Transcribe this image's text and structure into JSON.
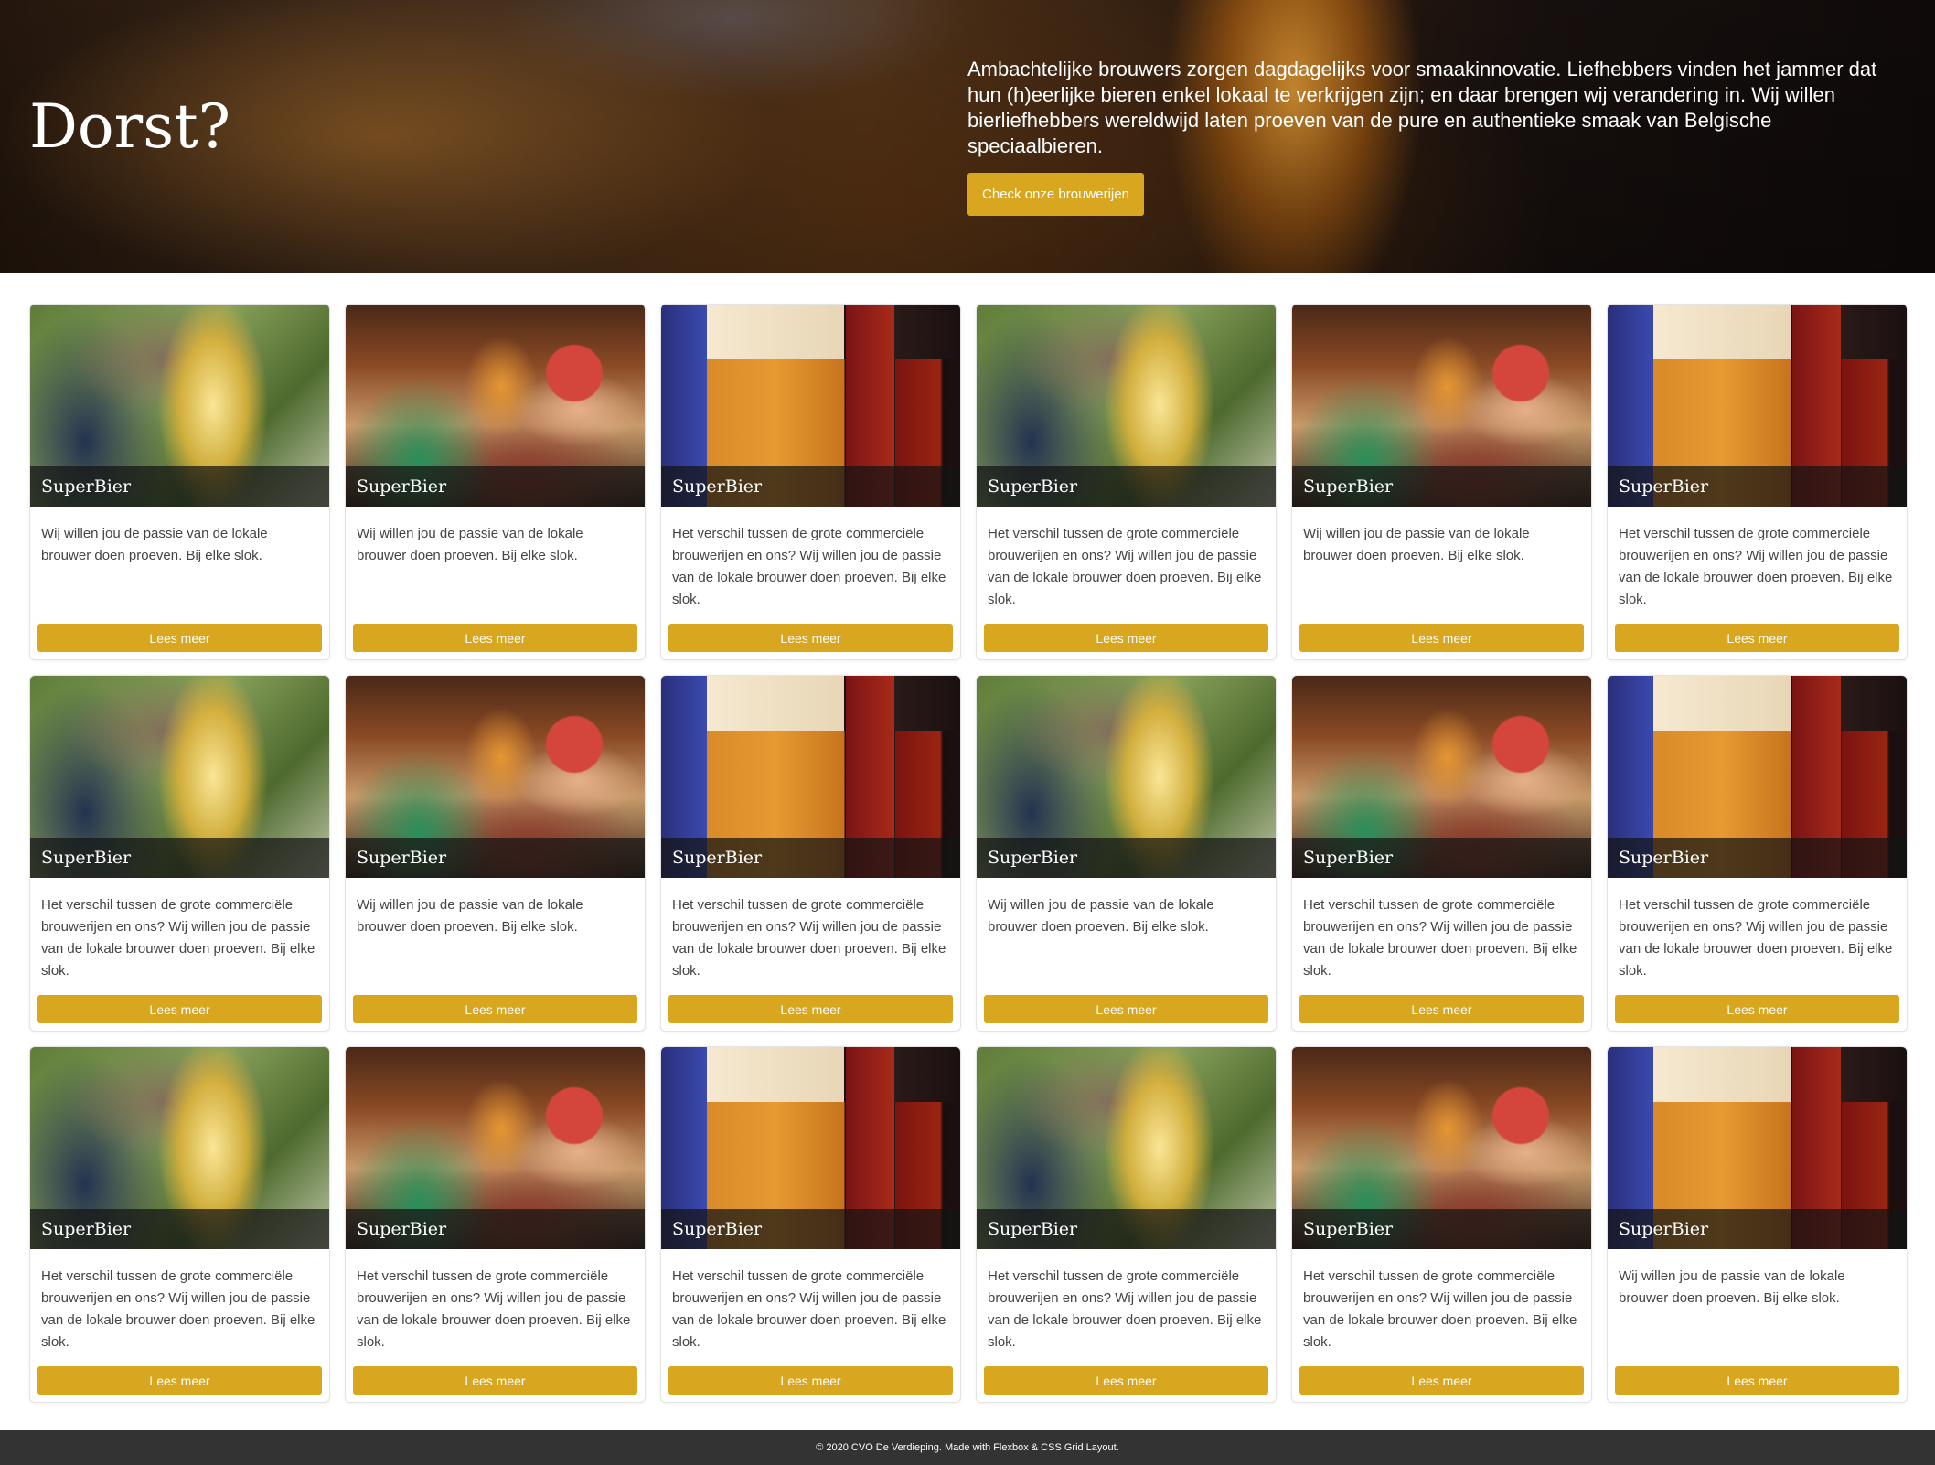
{
  "hero": {
    "title": "Dorst?",
    "text": "Ambachtelijke brouwers zorgen dagdagelijks voor smaakinnovatie. Liefhebbers vinden het jammer dat hun (h)eerlijke bieren enkel lokaal te verkrijgen zijn; en daar brengen wij verandering in. Wij willen bierliefhebbers wereldwijd laten proeven van de pure en authentieke smaak van Belgische speciaalbieren.",
    "button_label": "Check onze brouwerijen"
  },
  "cards": [
    {
      "title": "SuperBier",
      "text": "Wij willen jou de passie van de lokale brouwer doen proeven. Bij elke slok.",
      "button_label": "Lees meer",
      "photo": "beer-toast-hand"
    },
    {
      "title": "SuperBier",
      "text": "Wij willen jou de passie van de lokale brouwer doen proeven. Bij elke slok.",
      "button_label": "Lees meer",
      "photo": "people-cheering"
    },
    {
      "title": "SuperBier",
      "text": "Het verschil tussen de grote commerciële brouwerijen en ons? Wij willen jou de passie van de lokale brouwer doen proeven. Bij elke slok.",
      "button_label": "Lees meer",
      "photo": "beer-glasses"
    },
    {
      "title": "SuperBier",
      "text": "Het verschil tussen de grote commerciële brouwerijen en ons? Wij willen jou de passie van de lokale brouwer doen proeven. Bij elke slok.",
      "button_label": "Lees meer",
      "photo": "beer-toast-hand"
    },
    {
      "title": "SuperBier",
      "text": "Wij willen jou de passie van de lokale brouwer doen proeven. Bij elke slok.",
      "button_label": "Lees meer",
      "photo": "people-cheering"
    },
    {
      "title": "SuperBier",
      "text": "Het verschil tussen de grote commerciële brouwerijen en ons? Wij willen jou de passie van de lokale brouwer doen proeven. Bij elke slok.",
      "button_label": "Lees meer",
      "photo": "beer-glasses"
    },
    {
      "title": "SuperBier",
      "text": "Het verschil tussen de grote commerciële brouwerijen en ons? Wij willen jou de passie van de lokale brouwer doen proeven. Bij elke slok.",
      "button_label": "Lees meer",
      "photo": "beer-toast-hand"
    },
    {
      "title": "SuperBier",
      "text": "Wij willen jou de passie van de lokale brouwer doen proeven. Bij elke slok.",
      "button_label": "Lees meer",
      "photo": "people-cheering"
    },
    {
      "title": "SuperBier",
      "text": "Het verschil tussen de grote commerciële brouwerijen en ons? Wij willen jou de passie van de lokale brouwer doen proeven. Bij elke slok.",
      "button_label": "Lees meer",
      "photo": "beer-glasses"
    },
    {
      "title": "SuperBier",
      "text": "Wij willen jou de passie van de lokale brouwer doen proeven. Bij elke slok.",
      "button_label": "Lees meer",
      "photo": "beer-toast-hand"
    },
    {
      "title": "SuperBier",
      "text": "Het verschil tussen de grote commerciële brouwerijen en ons? Wij willen jou de passie van de lokale brouwer doen proeven. Bij elke slok.",
      "button_label": "Lees meer",
      "photo": "people-cheering"
    },
    {
      "title": "SuperBier",
      "text": "Het verschil tussen de grote commerciële brouwerijen en ons? Wij willen jou de passie van de lokale brouwer doen proeven. Bij elke slok.",
      "button_label": "Lees meer",
      "photo": "beer-glasses"
    },
    {
      "title": "SuperBier",
      "text": "Het verschil tussen de grote commerciële brouwerijen en ons? Wij willen jou de passie van de lokale brouwer doen proeven. Bij elke slok.",
      "button_label": "Lees meer",
      "photo": "beer-toast-hand"
    },
    {
      "title": "SuperBier",
      "text": "Het verschil tussen de grote commerciële brouwerijen en ons? Wij willen jou de passie van de lokale brouwer doen proeven. Bij elke slok.",
      "button_label": "Lees meer",
      "photo": "people-cheering"
    },
    {
      "title": "SuperBier",
      "text": "Het verschil tussen de grote commerciële brouwerijen en ons? Wij willen jou de passie van de lokale brouwer doen proeven. Bij elke slok.",
      "button_label": "Lees meer",
      "photo": "beer-glasses"
    },
    {
      "title": "SuperBier",
      "text": "Het verschil tussen de grote commerciële brouwerijen en ons? Wij willen jou de passie van de lokale brouwer doen proeven. Bij elke slok.",
      "button_label": "Lees meer",
      "photo": "beer-toast-hand"
    },
    {
      "title": "SuperBier",
      "text": "Het verschil tussen de grote commerciële brouwerijen en ons? Wij willen jou de passie van de lokale brouwer doen proeven. Bij elke slok.",
      "button_label": "Lees meer",
      "photo": "people-cheering"
    },
    {
      "title": "SuperBier",
      "text": "Wij willen jou de passie van de lokale brouwer doen proeven. Bij elke slok.",
      "button_label": "Lees meer",
      "photo": "beer-glasses"
    }
  ],
  "footer": {
    "text": "© 2020 CVO De Verdieping. Made with Flexbox & CSS Grid Layout."
  },
  "colors": {
    "accent": "#d9a620",
    "footer_bg": "#333333",
    "title_overlay": "#141414"
  }
}
